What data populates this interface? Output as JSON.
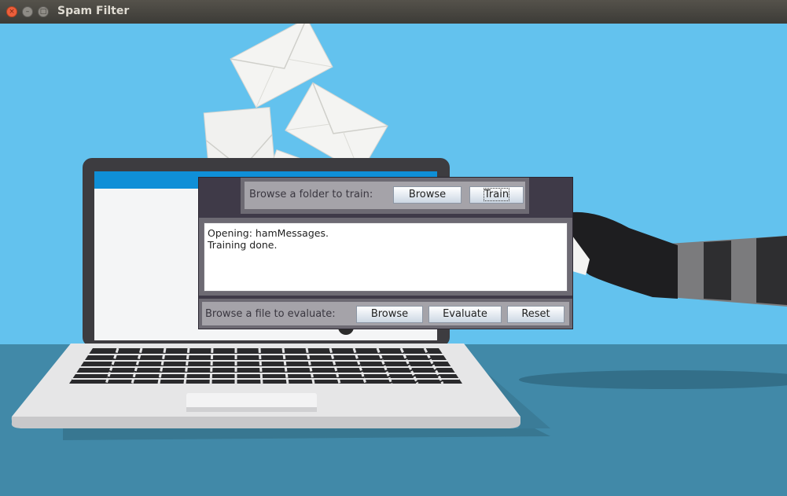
{
  "window": {
    "title": "Spam Filter",
    "close_glyph": "×",
    "min_glyph": "–",
    "max_glyph": "□"
  },
  "train_section": {
    "label": "Browse a folder to train:",
    "browse_label": "Browse",
    "train_label": "Train"
  },
  "log": {
    "text": "Opening: hamMessages.\nTraining done."
  },
  "evaluate_section": {
    "label": "Browse a file to evaluate:",
    "browse_label": "Browse",
    "evaluate_label": "Evaluate",
    "reset_label": "Reset"
  },
  "colors": {
    "sky": "#63c2ee",
    "floor": "#4189a8",
    "panel": "#3f3a48"
  }
}
